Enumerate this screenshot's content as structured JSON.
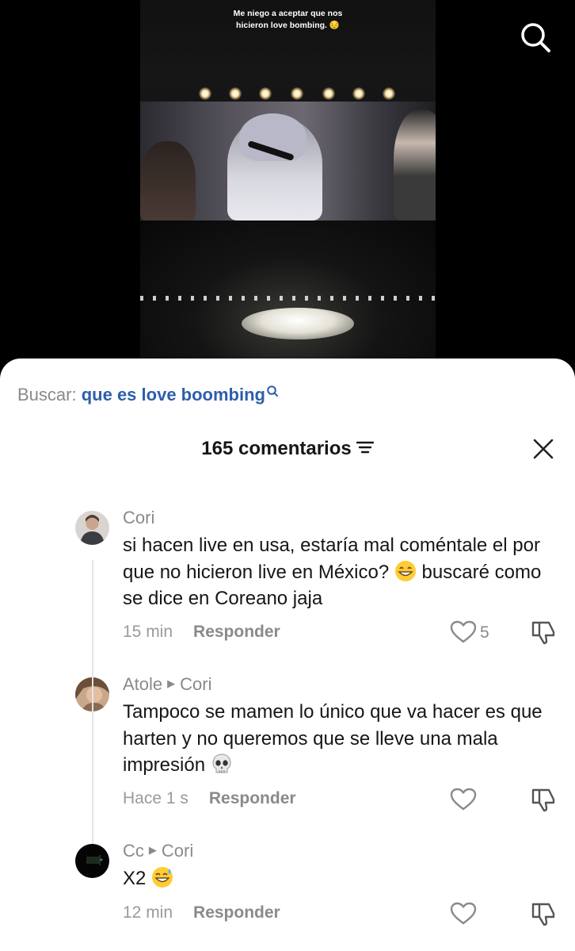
{
  "video": {
    "caption_line1": "Me niego a aceptar que nos",
    "caption_line2": "hicieron love bombing. 😔",
    "search_icon": "search-icon"
  },
  "search": {
    "prefix": "Buscar:",
    "term": "que es love boombing",
    "icon": "search-small-icon",
    "term_color": "#2d5fa9"
  },
  "header": {
    "count_label": "165 comentarios",
    "sort_icon": "sort-filter-icon",
    "close_icon": "close-icon"
  },
  "comments": [
    {
      "user": "Cori",
      "reply_to": "",
      "text": "si hacen live en usa, estaría mal coméntale el por que no hicieron live en México?",
      "emoji": "grinning-face-emoji",
      "text_line3": "buscaré como se dice en Coreano jaja",
      "time": "15 min",
      "reply_label": "Responder",
      "likes": "5"
    },
    {
      "user": "Atole",
      "reply_to": "Cori",
      "text": "Tampoco se mamen lo único que va hacer es que harten y no queremos que se lleve una mala impresión",
      "emoji": "skull-emoji",
      "time": "Hace 1 s",
      "reply_label": "Responder",
      "likes": ""
    },
    {
      "user": "Cc",
      "reply_to": "Cori",
      "text": "X2",
      "emoji": "sweat-smile-emoji",
      "time": "12 min",
      "reply_label": "Responder",
      "likes": ""
    }
  ],
  "colors": {
    "sheet_bg": "#ffffff",
    "text": "#161616",
    "muted": "#8a8a8a",
    "link": "#2d5fa9"
  }
}
